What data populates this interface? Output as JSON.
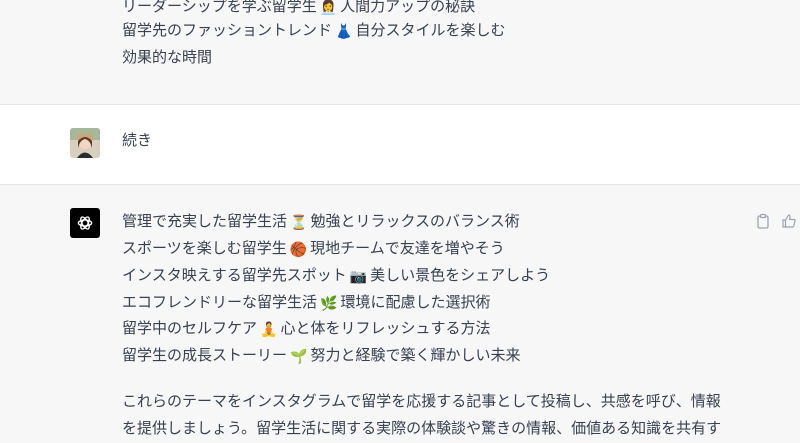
{
  "conversation": {
    "prev_assistant": {
      "lines": [
        {
          "text_a": "リーダーシップを学ぶ留学生",
          "emoji": "👩‍💼",
          "text_b": "人間力アップの秘訣"
        },
        {
          "text_a": "留学先のファッショントレンド",
          "emoji": "👗",
          "text_b": "自分スタイルを楽しむ"
        },
        {
          "text_a": "効果的な時間",
          "emoji": "",
          "text_b": ""
        }
      ]
    },
    "user_message": {
      "text": "続き"
    },
    "assistant_message": {
      "lines": [
        {
          "text_a": "管理で充実した留学生活",
          "emoji": "⏳",
          "text_b": "勉強とリラックスのバランス術"
        },
        {
          "text_a": "スポーツを楽しむ留学生",
          "emoji": "🏀",
          "text_b": "現地チームで友達を増やそう"
        },
        {
          "text_a": "インスタ映えする留学先スポット",
          "emoji": "📷",
          "text_b": "美しい景色をシェアしよう"
        },
        {
          "text_a": "エコフレンドリーな留学生活",
          "emoji": "🌿",
          "text_b": "環境に配慮した選択術"
        },
        {
          "text_a": "留学中のセルフケア",
          "emoji": "🧘",
          "text_b": "心と体をリフレッシュする方法"
        },
        {
          "text_a": "留学生の成長ストーリー",
          "emoji": "🌱",
          "text_b": "努力と経験で築く輝かしい未来"
        }
      ],
      "paragraph_line1": "これらのテーマをインスタグラムで留学を応援する記事として投稿し、共感を呼び、情報",
      "paragraph_line2": "を提供しましょう。留学生活に関する実際の体験談や驚きの情報、価値ある知識を共有す"
    },
    "icons": {
      "copy": "clipboard-icon",
      "thumbs_up": "thumbs-up-icon",
      "assistant_avatar": "openai-logo-icon",
      "user_avatar": "user-avatar"
    },
    "colors": {
      "assistant_bg": "#f7f7f8",
      "user_bg": "#ffffff",
      "text": "#374151"
    }
  }
}
